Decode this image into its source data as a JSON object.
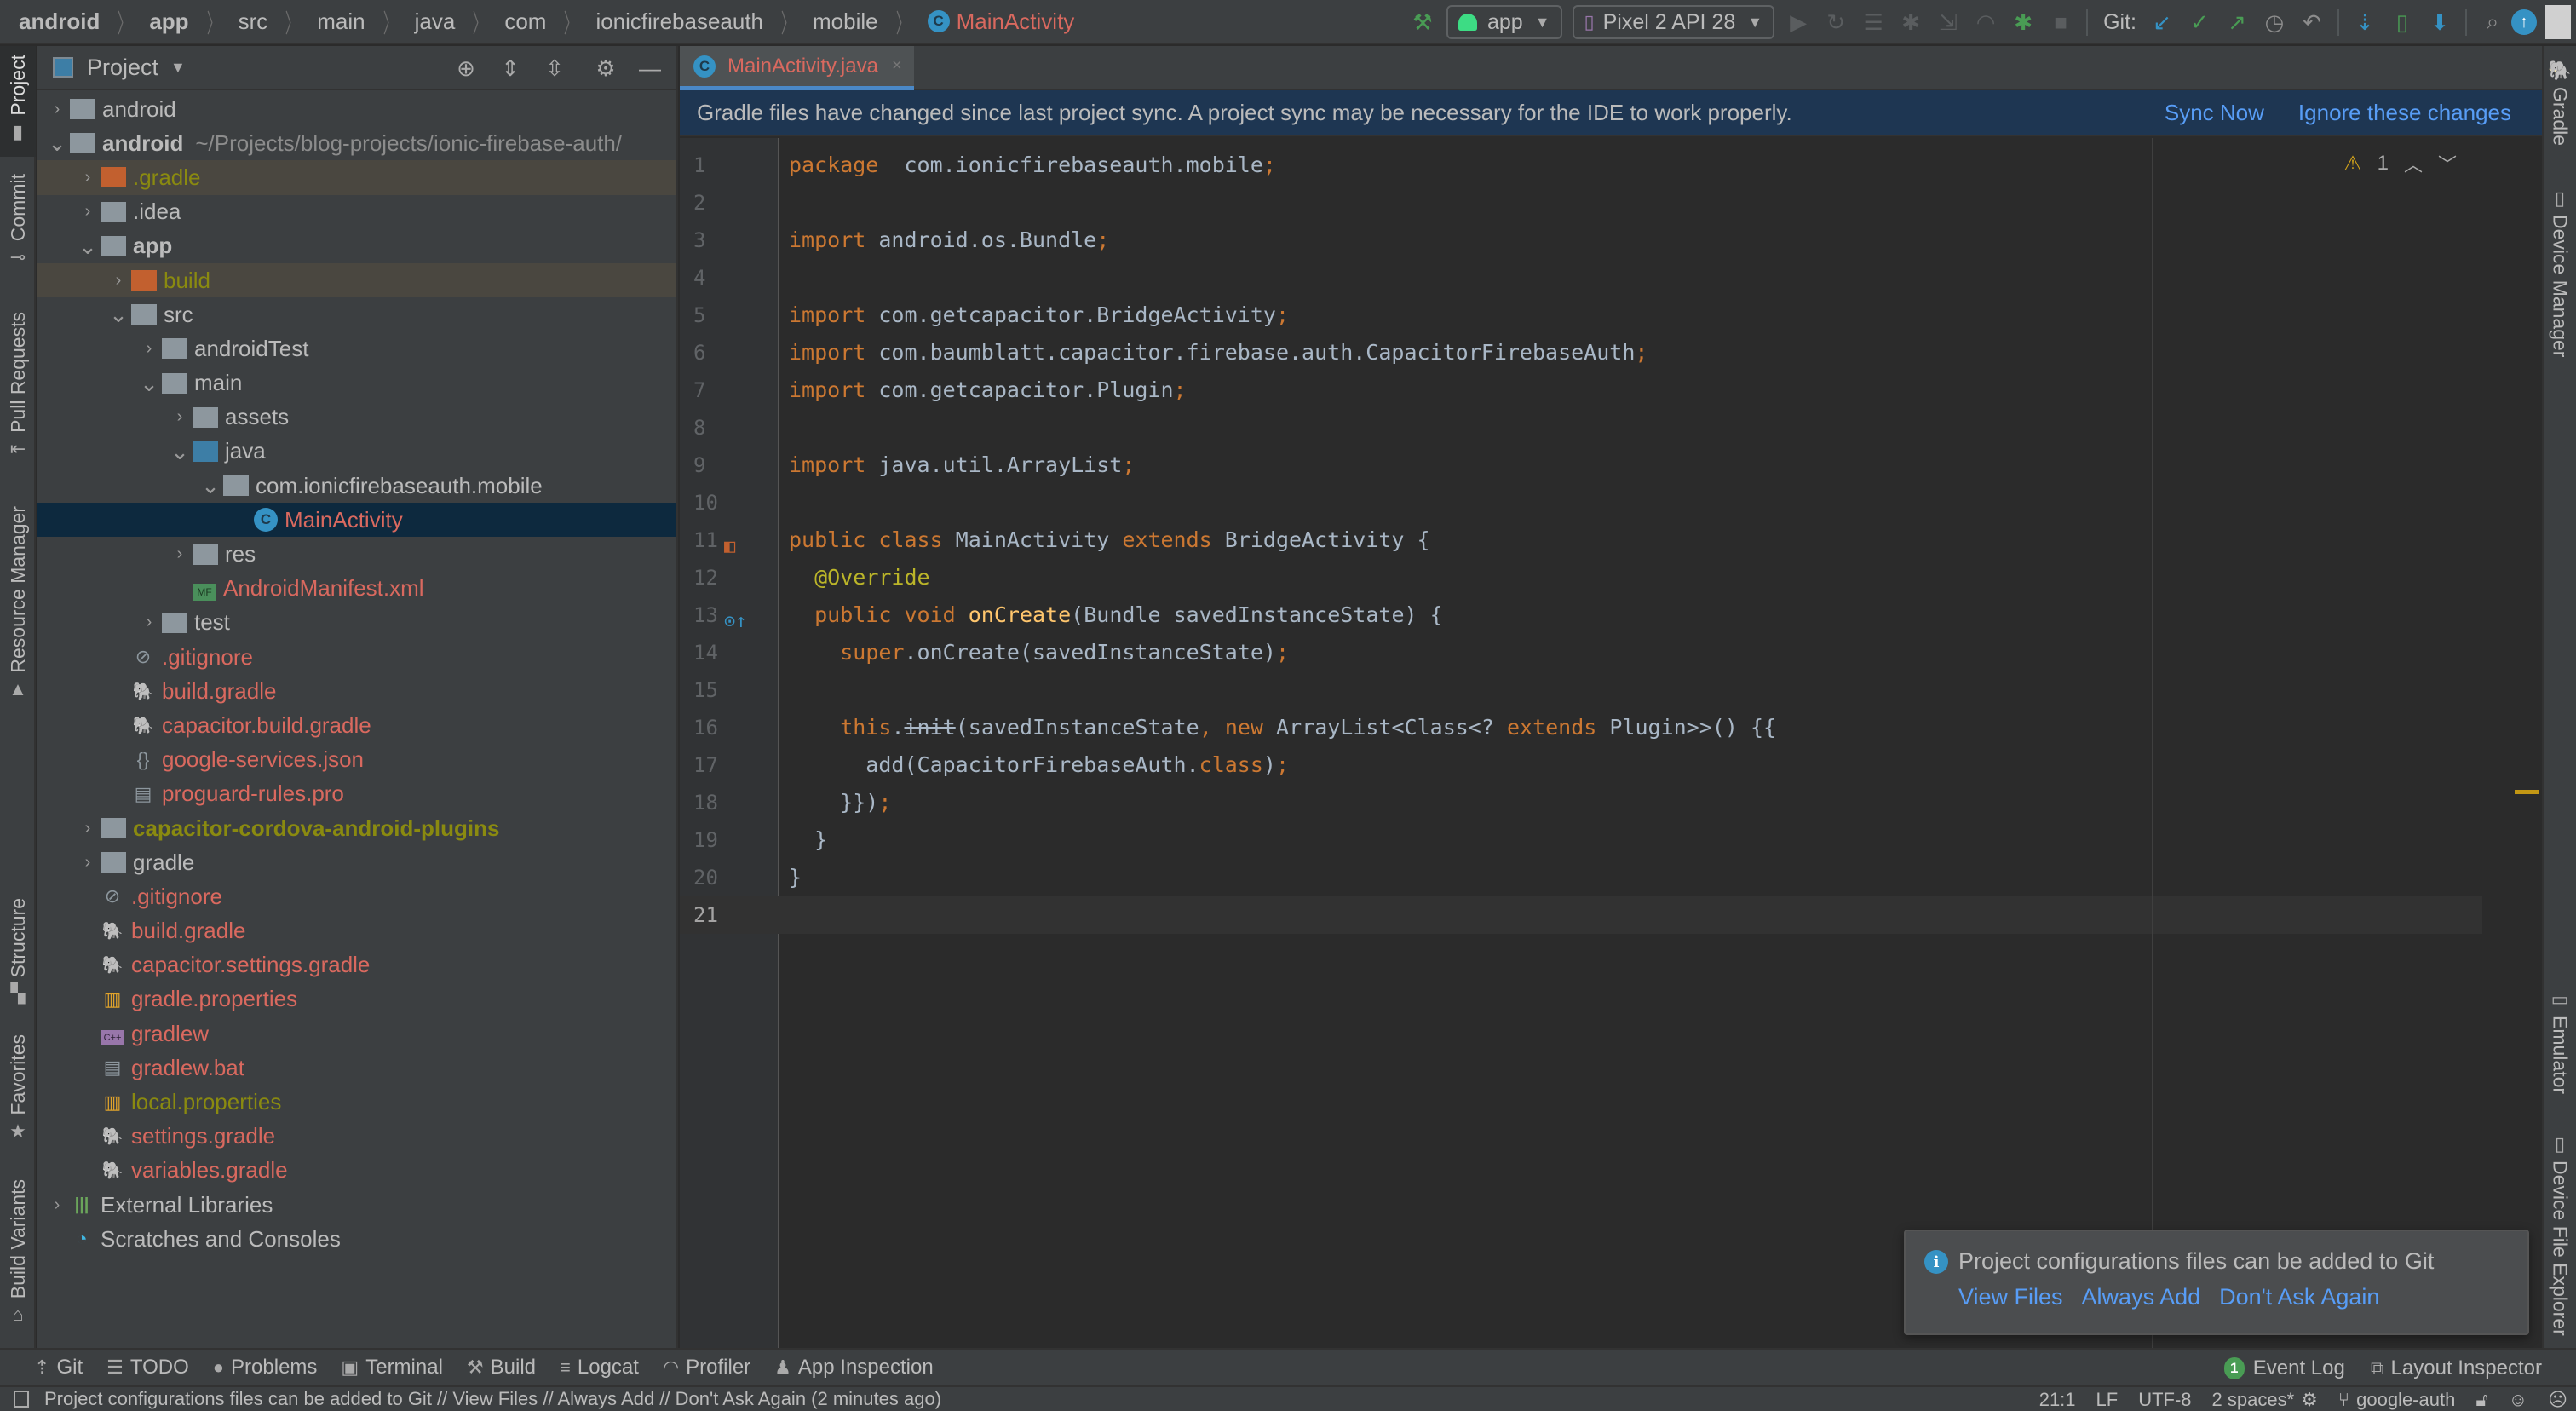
{
  "breadcrumbs": [
    {
      "label": "android",
      "bold": true
    },
    {
      "label": "app",
      "bold": true
    },
    {
      "label": "src"
    },
    {
      "label": "main"
    },
    {
      "label": "java"
    },
    {
      "label": "com"
    },
    {
      "label": "ionicfirebaseauth"
    },
    {
      "label": "mobile"
    },
    {
      "label": "MainActivity",
      "file": true,
      "icon": "class-icon"
    }
  ],
  "toolbar": {
    "run_config": "app",
    "device": "Pixel 2 API 28",
    "git_label": "Git:",
    "class_badge": "C"
  },
  "left_stripe": {
    "project": "Project",
    "commit": "Commit",
    "pull_requests": "Pull Requests",
    "resource_manager": "Resource Manager",
    "structure": "Structure",
    "favorites": "Favorites",
    "build_variants": "Build Variants"
  },
  "right_stripe": {
    "gradle": "Gradle",
    "device_manager": "Device Manager",
    "emulator": "Emulator",
    "device_file_explorer": "Device File Explorer"
  },
  "project_panel": {
    "title": "Project",
    "tree": [
      {
        "label": "android",
        "level": 0,
        "expand": "closed",
        "icon": "module-folder",
        "style": ""
      },
      {
        "label": "android",
        "level": 0,
        "expand": "open",
        "icon": "module-folder",
        "style": "bold",
        "path": "~/Projects/blog-projects/ionic-firebase-auth/"
      },
      {
        "label": ".gradle",
        "level": 1,
        "expand": "closed",
        "icon": "folder-orange",
        "style": "olive",
        "row": "ignored"
      },
      {
        "label": ".idea",
        "level": 1,
        "expand": "closed",
        "icon": "folder",
        "style": ""
      },
      {
        "label": "app",
        "level": 1,
        "expand": "open",
        "icon": "module-folder",
        "style": "bold"
      },
      {
        "label": "build",
        "level": 2,
        "expand": "closed",
        "icon": "folder-orange",
        "style": "olive",
        "row": "ignored"
      },
      {
        "label": "src",
        "level": 2,
        "expand": "open",
        "icon": "folder",
        "style": ""
      },
      {
        "label": "androidTest",
        "level": 3,
        "expand": "closed",
        "icon": "folder",
        "style": ""
      },
      {
        "label": "main",
        "level": 3,
        "expand": "open",
        "icon": "folder",
        "style": ""
      },
      {
        "label": "assets",
        "level": 4,
        "expand": "closed",
        "icon": "resource-folder",
        "style": ""
      },
      {
        "label": "java",
        "level": 4,
        "expand": "open",
        "icon": "folder-blue",
        "style": ""
      },
      {
        "label": "com.ionicfirebaseauth.mobile",
        "level": 5,
        "expand": "open",
        "icon": "package",
        "style": ""
      },
      {
        "label": "MainActivity",
        "level": 6,
        "expand": "none",
        "icon": "class",
        "style": "red",
        "row": "selected"
      },
      {
        "label": "res",
        "level": 4,
        "expand": "closed",
        "icon": "resource-folder",
        "style": ""
      },
      {
        "label": "AndroidManifest.xml",
        "level": 4,
        "expand": "none",
        "icon": "manifest",
        "style": "red"
      },
      {
        "label": "test",
        "level": 3,
        "expand": "closed",
        "icon": "folder",
        "style": ""
      },
      {
        "label": ".gitignore",
        "level": 2,
        "expand": "none",
        "icon": "gitignore",
        "style": "red"
      },
      {
        "label": "build.gradle",
        "level": 2,
        "expand": "none",
        "icon": "gradle",
        "style": "red"
      },
      {
        "label": "capacitor.build.gradle",
        "level": 2,
        "expand": "none",
        "icon": "gradle",
        "style": "red"
      },
      {
        "label": "google-services.json",
        "level": 2,
        "expand": "none",
        "icon": "json",
        "style": "red"
      },
      {
        "label": "proguard-rules.pro",
        "level": 2,
        "expand": "none",
        "icon": "text",
        "style": "red"
      },
      {
        "label": "capacitor-cordova-android-plugins",
        "level": 1,
        "expand": "closed",
        "icon": "module-folder",
        "style": "olive bold"
      },
      {
        "label": "gradle",
        "level": 1,
        "expand": "closed",
        "icon": "folder",
        "style": ""
      },
      {
        "label": ".gitignore",
        "level": 1,
        "expand": "none",
        "icon": "gitignore",
        "style": "red"
      },
      {
        "label": "build.gradle",
        "level": 1,
        "expand": "none",
        "icon": "gradle",
        "style": "red"
      },
      {
        "label": "capacitor.settings.gradle",
        "level": 1,
        "expand": "none",
        "icon": "gradle",
        "style": "red"
      },
      {
        "label": "gradle.properties",
        "level": 1,
        "expand": "none",
        "icon": "properties",
        "style": "red"
      },
      {
        "label": "gradlew",
        "level": 1,
        "expand": "none",
        "icon": "shell",
        "style": "red"
      },
      {
        "label": "gradlew.bat",
        "level": 1,
        "expand": "none",
        "icon": "text",
        "style": "red"
      },
      {
        "label": "local.properties",
        "level": 1,
        "expand": "none",
        "icon": "properties",
        "style": "olive"
      },
      {
        "label": "settings.gradle",
        "level": 1,
        "expand": "none",
        "icon": "gradle",
        "style": "red"
      },
      {
        "label": "variables.gradle",
        "level": 1,
        "expand": "none",
        "icon": "gradle",
        "style": "red"
      },
      {
        "label": "External Libraries",
        "level": 0,
        "expand": "closed",
        "icon": "libraries",
        "style": ""
      },
      {
        "label": "Scratches and Consoles",
        "level": 0,
        "expand": "none",
        "icon": "scratches",
        "style": ""
      }
    ]
  },
  "editor": {
    "tab": {
      "label": "MainActivity.java",
      "close": "×"
    },
    "banner": {
      "text": "Gradle files have changed since last project sync. A project sync may be necessary for the IDE to work properly.",
      "sync_now": "Sync Now",
      "ignore": "Ignore these changes"
    },
    "inspection": {
      "warnings": "1"
    },
    "current_line": 21,
    "lines": [
      [
        [
          "kw",
          "package"
        ],
        [
          "",
          "  com.ionicfirebaseauth.mobile"
        ],
        [
          "semi",
          ";"
        ]
      ],
      [],
      [
        [
          "kw",
          "import"
        ],
        [
          "",
          " android.os.Bundle"
        ],
        [
          "semi",
          ";"
        ]
      ],
      [],
      [
        [
          "kw",
          "import"
        ],
        [
          "",
          " com.getcapacitor.BridgeActivity"
        ],
        [
          "semi",
          ";"
        ]
      ],
      [
        [
          "kw",
          "import"
        ],
        [
          "",
          " com.baumblatt.capacitor.firebase.auth.CapacitorFirebaseAuth"
        ],
        [
          "semi",
          ";"
        ]
      ],
      [
        [
          "kw",
          "import"
        ],
        [
          "",
          " com.getcapacitor.Plugin"
        ],
        [
          "semi",
          ";"
        ]
      ],
      [],
      [
        [
          "kw",
          "import"
        ],
        [
          "",
          " java.util.ArrayList"
        ],
        [
          "semi",
          ";"
        ]
      ],
      [],
      [
        [
          "kw",
          "public class"
        ],
        [
          "",
          " MainActivity "
        ],
        [
          "kw",
          "extends"
        ],
        [
          "",
          " BridgeActivity {"
        ]
      ],
      [
        [
          "",
          "  "
        ],
        [
          "ann",
          "@Override"
        ]
      ],
      [
        [
          "",
          "  "
        ],
        [
          "kw",
          "public void"
        ],
        [
          "",
          " "
        ],
        [
          "fn",
          "onCreate"
        ],
        [
          "",
          "(Bundle savedInstanceState) {"
        ]
      ],
      [
        [
          "",
          "    "
        ],
        [
          "kw",
          "super"
        ],
        [
          "",
          ".onCreate(savedInstanceState)"
        ],
        [
          "semi",
          ";"
        ]
      ],
      [],
      [
        [
          "",
          "    "
        ],
        [
          "kw",
          "this"
        ],
        [
          "",
          "."
        ],
        [
          "strike",
          "init"
        ],
        [
          "",
          "(savedInstanceState"
        ],
        [
          "semi",
          ","
        ],
        [
          "",
          " "
        ],
        [
          "kw",
          "new"
        ],
        [
          "",
          " ArrayList<Class<? "
        ],
        [
          "kw",
          "extends"
        ],
        [
          "",
          " Plugin>>() {{"
        ]
      ],
      [
        [
          "",
          "      add(CapacitorFirebaseAuth."
        ],
        [
          "kw",
          "class"
        ],
        [
          "",
          ")"
        ],
        [
          "semi",
          ";"
        ]
      ],
      [
        [
          "",
          "    }})"
        ],
        [
          "semi",
          ";"
        ]
      ],
      [
        [
          "",
          "  }"
        ]
      ],
      [
        [
          "",
          "}"
        ]
      ],
      []
    ]
  },
  "notification": {
    "text": "Project configurations files can be added to Git",
    "actions": [
      "View Files",
      "Always Add",
      "Don't Ask Again"
    ]
  },
  "bottom_tools": [
    {
      "label": "Git",
      "icon": "git-icon"
    },
    {
      "label": "TODO",
      "icon": "todo-icon"
    },
    {
      "label": "Problems",
      "icon": "problems-icon"
    },
    {
      "label": "Terminal",
      "icon": "terminal-icon"
    },
    {
      "label": "Build",
      "icon": "build-icon"
    },
    {
      "label": "Logcat",
      "icon": "logcat-icon"
    },
    {
      "label": "Profiler",
      "icon": "profiler-icon"
    },
    {
      "label": "App Inspection",
      "icon": "app-inspection-icon"
    }
  ],
  "bottom_right": {
    "event_log": "Event Log",
    "event_count": "1",
    "layout_inspector": "Layout Inspector"
  },
  "status_bar": {
    "message": "Project configurations files can be added to Git // View Files // Always Add // Don't Ask Again (2 minutes ago)",
    "position": "21:1",
    "line_sep": "LF",
    "encoding": "UTF-8",
    "indent": "2 spaces*",
    "branch": "google-auth"
  },
  "colors": {
    "accent": "#4a88c7",
    "modified_file": "#d9695f",
    "ignored_file": "#8a8a10",
    "link": "#589df6",
    "banner_bg": "#1e3652",
    "selection": "#0d293e"
  }
}
